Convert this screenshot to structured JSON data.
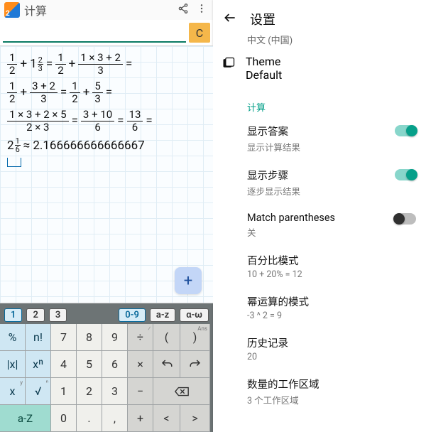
{
  "left": {
    "app_title": "计算",
    "input_value": "",
    "clear_label": "C",
    "fab_label": "+",
    "math_lines": [
      {
        "parts": [
          {
            "t": "fr",
            "n": "1",
            "d": "2"
          },
          {
            "t": "sym",
            "v": "+"
          },
          {
            "t": "mix",
            "w": "1",
            "n": "2",
            "d": "3"
          },
          {
            "t": "sym",
            "v": "="
          },
          {
            "t": "fr",
            "n": "1",
            "d": "2"
          },
          {
            "t": "sym",
            "v": "+"
          },
          {
            "t": "fr",
            "n": "1 × 3 + 2",
            "d": "3"
          },
          {
            "t": "sym",
            "v": "="
          }
        ]
      },
      {
        "parts": [
          {
            "t": "fr",
            "n": "1",
            "d": "2"
          },
          {
            "t": "sym",
            "v": "+"
          },
          {
            "t": "fr",
            "n": "3 + 2",
            "d": "3"
          },
          {
            "t": "sym",
            "v": "="
          },
          {
            "t": "fr",
            "n": "1",
            "d": "2"
          },
          {
            "t": "sym",
            "v": "+"
          },
          {
            "t": "fr",
            "n": "5",
            "d": "3"
          },
          {
            "t": "sym",
            "v": "="
          }
        ]
      },
      {
        "parts": [
          {
            "t": "fr",
            "n": "1 × 3 + 2 × 5",
            "d": "2 × 3"
          },
          {
            "t": "sym",
            "v": "="
          },
          {
            "t": "fr",
            "n": "3 + 10",
            "d": "6"
          },
          {
            "t": "sym",
            "v": "="
          },
          {
            "t": "fr",
            "n": "13",
            "d": "6"
          },
          {
            "t": "sym",
            "v": "="
          }
        ]
      },
      {
        "parts": [
          {
            "t": "mix",
            "w": "2",
            "n": "1",
            "d": "6"
          },
          {
            "t": "sym",
            "v": "≈"
          },
          {
            "t": "sym",
            "v": "2.166666666666667"
          }
        ]
      }
    ],
    "tabs": {
      "page_active": "1",
      "pages": [
        "1",
        "2",
        "3"
      ],
      "mode_active": "0-9",
      "modes": [
        "0-9",
        "a-z",
        "α-ω"
      ]
    },
    "keys": {
      "r1": [
        {
          "l": "%",
          "c": "blue"
        },
        {
          "l": "n!",
          "c": "blue"
        },
        {
          "l": "7",
          "c": "lg"
        },
        {
          "l": "8",
          "c": "lg"
        },
        {
          "l": "9",
          "c": "lg"
        },
        {
          "l": "÷",
          "c": "mg",
          "sup": "⁄"
        },
        {
          "l": "(",
          "c": "mg"
        },
        {
          "l": ")",
          "c": "mg",
          "sup": "Ans"
        }
      ],
      "r2": [
        {
          "l": "|x|",
          "c": "blue"
        },
        {
          "l": "xⁿ",
          "c": "blue"
        },
        {
          "l": "4",
          "c": "lg"
        },
        {
          "l": "5",
          "c": "lg"
        },
        {
          "l": "6",
          "c": "lg"
        },
        {
          "l": "×",
          "c": "mg"
        },
        {
          "l": "↶",
          "c": "mg"
        },
        {
          "l": "↷",
          "c": "mg"
        }
      ],
      "r3": [
        {
          "l": "x",
          "c": "blue",
          "sup": "y"
        },
        {
          "l": "√",
          "c": "blue",
          "sup": "ⁿ"
        },
        {
          "l": "1",
          "c": "lg"
        },
        {
          "l": "2",
          "c": "lg"
        },
        {
          "l": "3",
          "c": "lg"
        },
        {
          "l": "−",
          "c": "mg"
        },
        {
          "l": "bksp",
          "c": "mg",
          "wide": 2
        }
      ],
      "r4": [
        {
          "l": "a-Z",
          "c": "aZ",
          "wide": 2
        },
        {
          "l": "0",
          "c": "lg"
        },
        {
          "l": ".",
          "c": "lg"
        },
        {
          "l": ",",
          "c": "lg"
        },
        {
          "l": "+",
          "c": "mg"
        },
        {
          "l": "<",
          "c": "mg"
        },
        {
          "l": ">",
          "c": "mg"
        }
      ]
    }
  },
  "right": {
    "title": "设置",
    "clipped_lang": "中文 (中国)",
    "theme": {
      "title": "Theme",
      "value": "Default"
    },
    "section_calc": "计算",
    "items": [
      {
        "title": "显示答案",
        "sub": "显示计算结果",
        "toggle": "on"
      },
      {
        "title": "显示步骤",
        "sub": "逐步显示结果",
        "toggle": "on"
      },
      {
        "title": "Match parentheses",
        "sub": "关",
        "toggle": "off"
      },
      {
        "title": "百分比模式",
        "sub": "10 + 20% = 12",
        "toggle": null
      },
      {
        "title": "幂运算的模式",
        "sub": "-3 ^ 2 = 9",
        "toggle": null
      },
      {
        "title": "历史记录",
        "sub": "20",
        "toggle": null
      },
      {
        "title": "数量的工作区域",
        "sub": "3 个工作区域",
        "toggle": null
      }
    ]
  }
}
